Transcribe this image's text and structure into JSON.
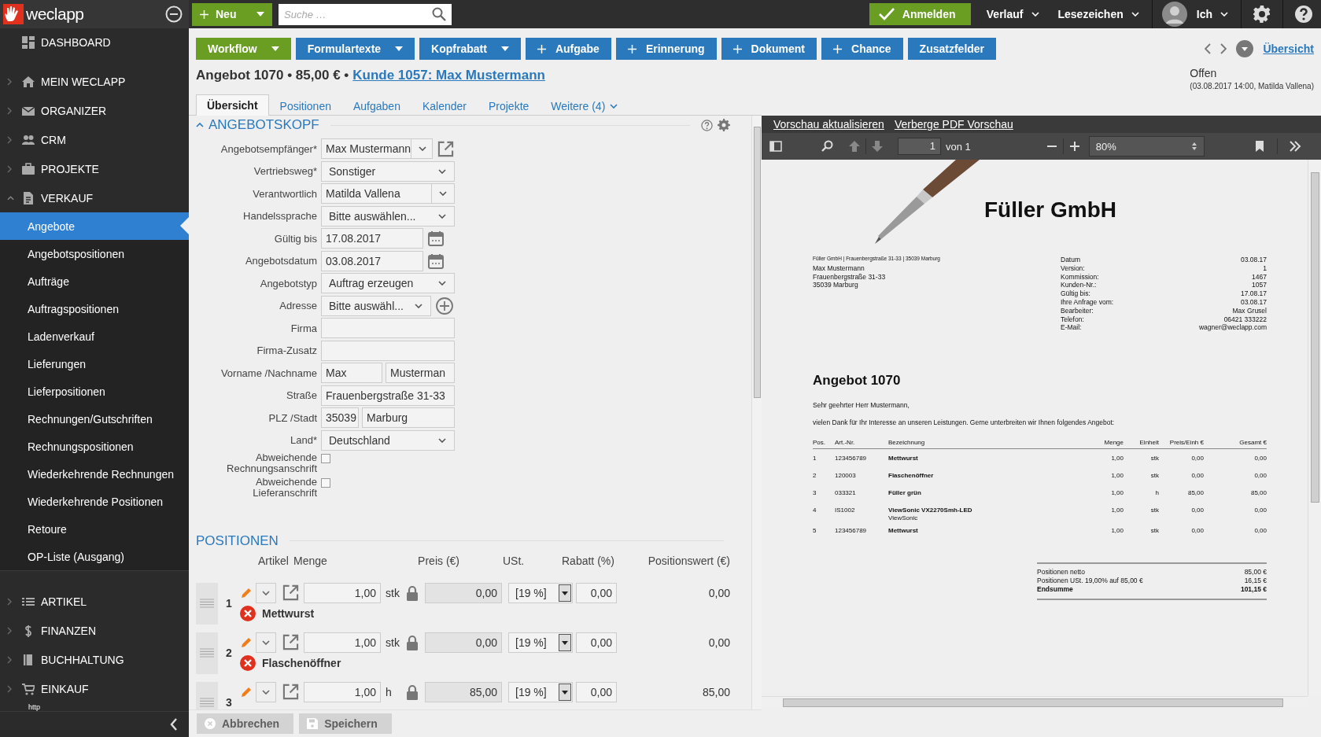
{
  "topbar": {
    "logo": "weclapp",
    "new_button": "Neu",
    "search": {
      "placeholder": "Suche …"
    },
    "login_button": "Anmelden",
    "menus": [
      {
        "label": "Verlauf"
      },
      {
        "label": "Lesezeichen"
      }
    ],
    "user": "Ich"
  },
  "sidebar": {
    "items": [
      {
        "label": "DASHBOARD",
        "kind": "link"
      },
      {
        "label": "MEIN WECLAPP",
        "kind": "group",
        "expanded": false
      },
      {
        "label": "ORGANIZER",
        "kind": "group",
        "expanded": false
      },
      {
        "label": "CRM",
        "kind": "group",
        "expanded": false
      },
      {
        "label": "PROJEKTE",
        "kind": "group",
        "expanded": false
      },
      {
        "label": "VERKAUF",
        "kind": "group",
        "expanded": true,
        "children": [
          {
            "label": "Angebote",
            "selected": true
          },
          {
            "label": "Angebotspositionen",
            "selected": false
          },
          {
            "label": "Aufträge",
            "selected": false
          },
          {
            "label": "Auftragspositionen",
            "selected": false
          },
          {
            "label": "Ladenverkauf",
            "selected": false
          },
          {
            "label": "Lieferungen",
            "selected": false
          },
          {
            "label": "Lieferpositionen",
            "selected": false
          },
          {
            "label": "Rechnungen/Gutschriften",
            "selected": false
          },
          {
            "label": "Rechnungspositionen",
            "selected": false
          },
          {
            "label": "Wiederkehrende Rechnungen",
            "selected": false
          },
          {
            "label": "Wiederkehrende Positionen",
            "selected": false
          },
          {
            "label": "Retoure",
            "selected": false
          },
          {
            "label": "OP-Liste (Ausgang)",
            "selected": false
          }
        ]
      },
      {
        "label": "ARTIKEL",
        "kind": "group",
        "expanded": false
      },
      {
        "label": "FINANZEN",
        "kind": "group",
        "expanded": false
      },
      {
        "label": "BUCHHALTUNG",
        "kind": "group",
        "expanded": false
      },
      {
        "label": "EINKAUF",
        "kind": "group",
        "expanded": false
      }
    ],
    "status_text": "http"
  },
  "actions": {
    "buttons": [
      {
        "label": "Workflow",
        "kind": "menu",
        "color": "#6a9e22"
      },
      {
        "label": "Formulartexte",
        "kind": "menu",
        "color": "#2a79bd"
      },
      {
        "label": "Kopfrabatt",
        "kind": "menu",
        "color": "#2a79bd"
      },
      {
        "label": "Aufgabe",
        "kind": "add",
        "color": "#2a79bd"
      },
      {
        "label": "Erinnerung",
        "kind": "add",
        "color": "#2a79bd"
      },
      {
        "label": "Dokument",
        "kind": "add",
        "color": "#2a79bd"
      },
      {
        "label": "Chance",
        "kind": "add",
        "color": "#2a79bd"
      },
      {
        "label": "Zusatzfelder",
        "kind": "plain",
        "color": "#2a79bd"
      }
    ],
    "overview_link": "Übersicht"
  },
  "header": {
    "title": "Angebot 1070 • 85,00 € •",
    "customer_link": "Kunde 1057: Max Mustermann",
    "status": "Offen",
    "status_detail": "(03.08.2017 14:00, Matilda Vallena)"
  },
  "tabs": [
    {
      "label": "Übersicht",
      "selected": true,
      "kind": "tab"
    },
    {
      "label": "Positionen",
      "selected": false,
      "kind": "tab"
    },
    {
      "label": "Aufgaben",
      "selected": false,
      "kind": "tab"
    },
    {
      "label": "Kalender",
      "selected": false,
      "kind": "tab"
    },
    {
      "label": "Projekte",
      "selected": false,
      "kind": "tab"
    },
    {
      "label": "Weitere (4)",
      "selected": false,
      "kind": "menu"
    }
  ],
  "form": {
    "section": {
      "title": "ANGEBOTSKOPF",
      "expanded": true
    },
    "rows": [
      {
        "label": "Angebotsempfänger*",
        "kind": "combo-link",
        "value": "Max Mustermann"
      },
      {
        "label": "Vertriebsweg*",
        "kind": "select",
        "value": "Sonstiger"
      },
      {
        "label": "Verantwortlich",
        "kind": "combo",
        "value": "Matilda Vallena"
      },
      {
        "label": "Handelssprache",
        "kind": "select",
        "value": "Bitte auswählen..."
      },
      {
        "label": "Gültig bis",
        "kind": "date",
        "value": "17.08.2017"
      },
      {
        "label": "Angebotsdatum",
        "kind": "date",
        "value": "03.08.2017"
      },
      {
        "label": "Angebotstyp",
        "kind": "select",
        "value": "Auftrag erzeugen"
      },
      {
        "label": "Adresse",
        "kind": "select-add",
        "value": "Bitte auswähl..."
      },
      {
        "label": "Firma",
        "kind": "text"
      },
      {
        "label": "Firma-Zusatz",
        "kind": "text"
      },
      {
        "label": "Vorname /Nachname",
        "kind": "pair-even",
        "values": [
          "Max",
          "Musterman"
        ]
      },
      {
        "label": "Straße",
        "kind": "text",
        "value": "Frauenbergstraße 31-33"
      },
      {
        "label": "PLZ /Stadt",
        "kind": "pair-zip",
        "values": [
          "35039",
          "Marburg"
        ]
      },
      {
        "label": "Land*",
        "kind": "select",
        "value": "Deutschland"
      },
      {
        "label": "Abweichende Rechnungsanschrift",
        "kind": "checkbox",
        "checked": false
      },
      {
        "label": "Abweichende Lieferanschrift",
        "kind": "checkbox",
        "checked": false
      }
    ]
  },
  "positions": {
    "title": "POSITIONEN",
    "columns": [
      "Artikel",
      "Menge",
      "Preis (€)",
      "USt.",
      "Rabatt (%)",
      "Positionswert (€)"
    ],
    "rows": [
      {
        "number": "1",
        "quantity": "1,00",
        "unit": "stk",
        "price": "0,00",
        "tax": "[19 %]",
        "discount": "0,00",
        "value": "0,00",
        "name": "Mettwurst"
      },
      {
        "number": "2",
        "quantity": "1,00",
        "unit": "stk",
        "price": "0,00",
        "tax": "[19 %]",
        "discount": "0,00",
        "value": "0,00",
        "name": "Flaschenöffner"
      },
      {
        "number": "3",
        "quantity": "1,00",
        "unit": "h",
        "price": "85,00",
        "tax": "[19 %]",
        "discount": "0,00",
        "value": "85,00"
      }
    ]
  },
  "footer": {
    "buttons": [
      {
        "label": "Abbrechen",
        "disabled": true
      },
      {
        "label": "Speichern",
        "disabled": true
      }
    ]
  },
  "pdf": {
    "links": [
      "Vorschau aktualisieren",
      "Verberge PDF Vorschau"
    ],
    "page": "1",
    "page_count": "von 1",
    "zoom": "80%",
    "document": {
      "company": "Füller GmbH",
      "sender_line": "Füller GmbH | Frauenbergstraße 31-33 | 35039 Marburg",
      "address": [
        "Max Mustermann",
        "Frauenbergstraße 31-33",
        "35039 Marburg"
      ],
      "meta": [
        {
          "label": "Datum",
          "value": "03.08.17"
        },
        {
          "label": "Version:",
          "value": "1"
        },
        {
          "label": "Kommission:",
          "value": "1467"
        },
        {
          "label": "Kunden-Nr.:",
          "value": "1057"
        },
        {
          "label": "Gültig bis:",
          "value": "17.08.17"
        },
        {
          "label": "Ihre Anfrage vom:",
          "value": "03.08.17"
        },
        {
          "label": "Bearbeiter:",
          "value": "Max Grusel"
        },
        {
          "label": "Telefon:",
          "value": "06421 333222"
        },
        {
          "label": "E-Mail:",
          "value": "wagner@weclapp.com"
        }
      ],
      "title": "Angebot 1070",
      "greeting": "Sehr geehrter Herr Mustermann,",
      "intro": "vielen Dank für Ihr Interesse an unseren Leistungen. Gerne unterbreiten wir Ihnen folgendes Angebot:",
      "table": {
        "columns": [
          "Pos.",
          "Art.-Nr.",
          "Bezeichnung",
          "Menge",
          "Einheit",
          "Preis/Einh €",
          "Gesamt €"
        ],
        "rows": [
          {
            "cells": [
              "1",
              "123456789",
              "Mettwurst",
              "1,00",
              "stk",
              "0,00",
              "0,00"
            ]
          },
          {
            "cells": [
              "2",
              "120003",
              "Flaschenöffner",
              "1,00",
              "stk",
              "0,00",
              "0,00"
            ]
          },
          {
            "cells": [
              "3",
              "033321",
              "Füller grün",
              "1,00",
              "h",
              "85,00",
              "85,00"
            ]
          },
          {
            "cells": [
              "4",
              "IS1002",
              "ViewSonic VX2270Smh-LED",
              "1,00",
              "stk",
              "0,00",
              "0,00"
            ],
            "note": "ViewSonic"
          },
          {
            "cells": [
              "5",
              "123456789",
              "Mettwurst",
              "1,00",
              "stk",
              "0,00",
              "0,00"
            ]
          }
        ]
      },
      "totals": [
        {
          "label": "Positionen netto",
          "value": "85,00 €",
          "kind": "line"
        },
        {
          "label": "Positionen USt. 19,00% auf 85,00 €",
          "value": "16,15 €",
          "kind": "line"
        },
        {
          "label": "Endsumme",
          "value": "101,15 €",
          "kind": "sum"
        }
      ]
    }
  }
}
